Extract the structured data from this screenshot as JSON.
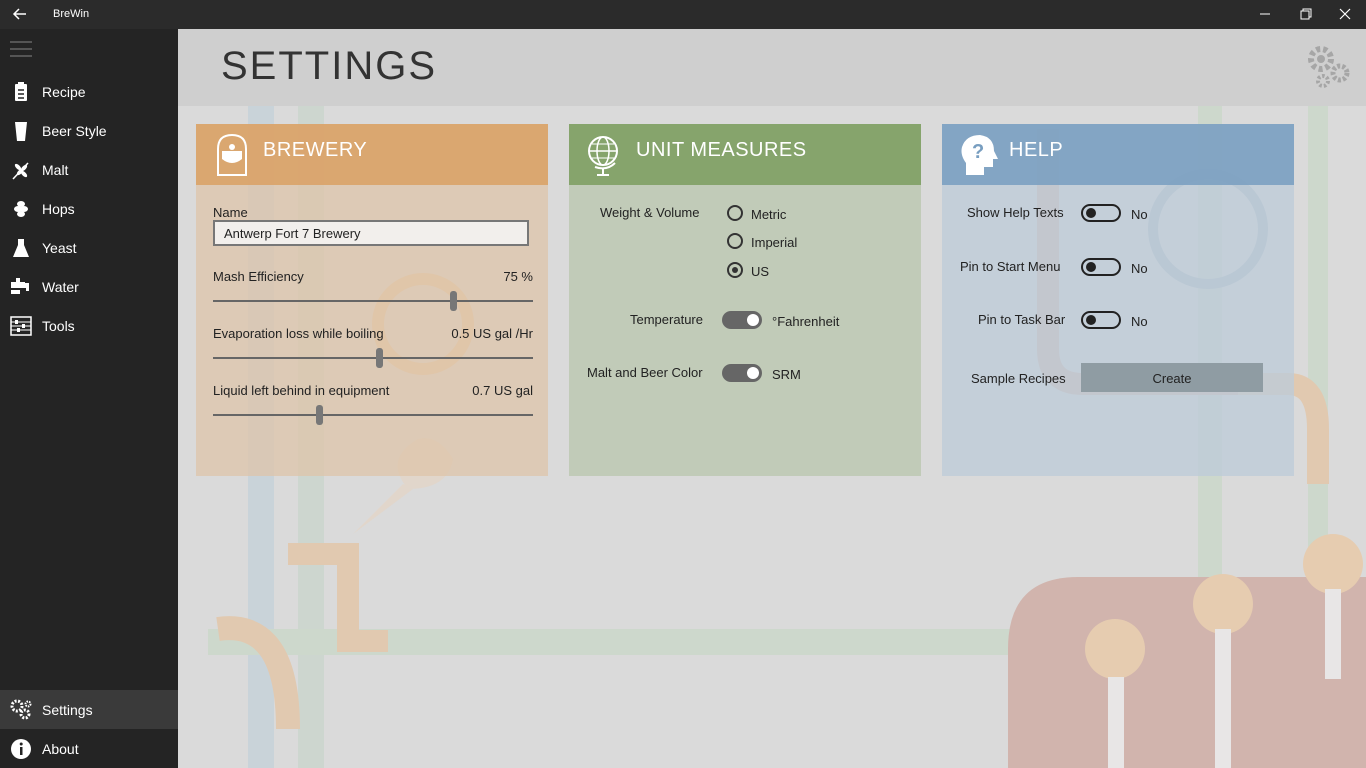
{
  "window": {
    "title": "BreWin"
  },
  "sidebar": {
    "items": [
      {
        "label": "Recipe",
        "icon": "clipboard-icon"
      },
      {
        "label": "Beer Style",
        "icon": "glass-icon"
      },
      {
        "label": "Malt",
        "icon": "wheat-icon"
      },
      {
        "label": "Hops",
        "icon": "hop-icon"
      },
      {
        "label": "Yeast",
        "icon": "flask-icon"
      },
      {
        "label": "Water",
        "icon": "faucet-icon"
      },
      {
        "label": "Tools",
        "icon": "abacus-icon"
      }
    ],
    "bottom": [
      {
        "label": "Settings",
        "icon": "gears-icon",
        "active": true
      },
      {
        "label": "About",
        "icon": "info-icon"
      }
    ]
  },
  "page": {
    "title": "SETTINGS"
  },
  "brewery": {
    "title": "BREWERY",
    "name_label": "Name",
    "name_value": "Antwerp Fort 7 Brewery",
    "mash_label": "Mash Efficiency",
    "mash_value": "75 %",
    "mash_fraction": 0.75,
    "evap_label": "Evaporation loss while boiling",
    "evap_value": "0.5 US gal /Hr",
    "evap_fraction": 0.52,
    "liquid_label": "Liquid left behind in equipment",
    "liquid_value": "0.7 US gal",
    "liquid_fraction": 0.33
  },
  "units": {
    "title": "UNIT MEASURES",
    "weight_label": "Weight & Volume",
    "options": [
      "Metric",
      "Imperial",
      "US"
    ],
    "selected": "US",
    "temperature_label": "Temperature",
    "temperature_value": "°Fahrenheit",
    "color_label": "Malt and Beer Color",
    "color_value": "SRM"
  },
  "help": {
    "title": "HELP",
    "show_help_label": "Show Help Texts",
    "show_help_value": "No",
    "pin_start_label": "Pin to Start Menu",
    "pin_start_value": "No",
    "pin_task_label": "Pin to Task Bar",
    "pin_task_value": "No",
    "samples_label": "Sample Recipes",
    "create_label": "Create"
  },
  "colors": {
    "brewery_header": "#da9e5f",
    "units_header": "#80a064",
    "help_header": "#789ec0",
    "sidebar_bg": "#242424"
  }
}
